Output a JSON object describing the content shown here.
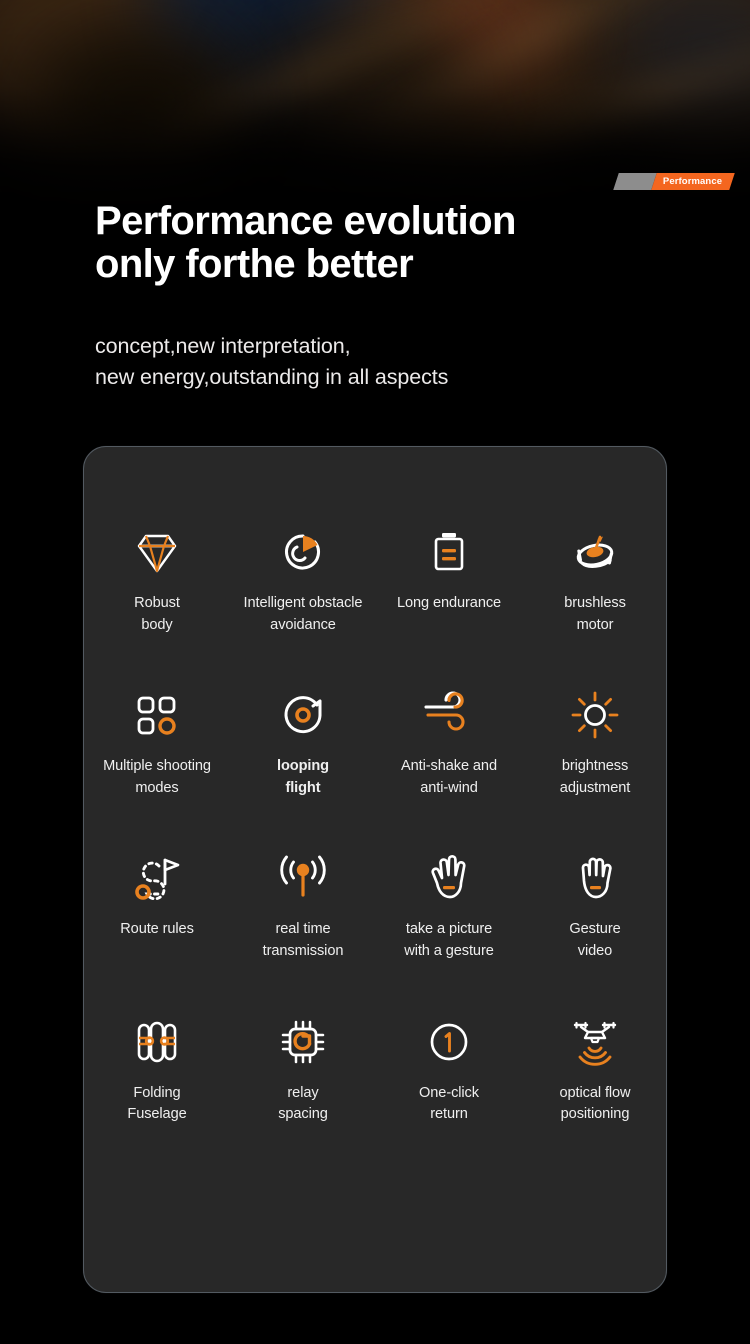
{
  "badge": {
    "gray_label": "",
    "label": "Performance"
  },
  "header": {
    "headline": "Performance evolution\nonly forthe better",
    "subtitle": "concept,new interpretation,\nnew energy,outstanding in all aspects"
  },
  "colors": {
    "accent_orange": "#e8811f",
    "badge_orange": "#f4661f",
    "badge_gray": "#8d8d8d",
    "icon_white": "#ffffff",
    "card_bg": "#282828",
    "card_border": "#535a61",
    "page_bg": "#000000",
    "text_white": "#efefef"
  },
  "features": [
    {
      "icon": "diamond-icon",
      "label": "Robust\nbody",
      "bold": false
    },
    {
      "icon": "obstacle-avoidance-icon",
      "label": "Intelligent obstacle\navoidance",
      "bold": false
    },
    {
      "icon": "battery-icon",
      "label": "Long endurance",
      "bold": false
    },
    {
      "icon": "brushless-motor-icon",
      "label": "brushless\nmotor",
      "bold": false
    },
    {
      "icon": "multi-shot-grid-icon",
      "label": "Multiple shooting\nmodes",
      "bold": false
    },
    {
      "icon": "looping-flight-icon",
      "label": "looping\nflight",
      "bold": true
    },
    {
      "icon": "wind-icon",
      "label": "Anti-shake and\nanti-wind",
      "bold": false
    },
    {
      "icon": "brightness-sun-icon",
      "label": "brightness\nadjustment",
      "bold": false
    },
    {
      "icon": "route-flag-icon",
      "label": "Route rules",
      "bold": false
    },
    {
      "icon": "signal-tower-icon",
      "label": "real time\ntransmission",
      "bold": false
    },
    {
      "icon": "open-hand-icon",
      "label": "take a picture\nwith a gesture",
      "bold": false
    },
    {
      "icon": "closed-hand-icon",
      "label": "Gesture\nvideo",
      "bold": false
    },
    {
      "icon": "folding-fuselage-icon",
      "label": "Folding\nFuselage",
      "bold": false
    },
    {
      "icon": "chip-icon",
      "label": "relay\nspacing",
      "bold": false
    },
    {
      "icon": "one-click-return-icon",
      "label": "One-click\nreturn",
      "bold": false
    },
    {
      "icon": "optical-flow-drone-icon",
      "label": "optical flow\npositioning",
      "bold": false
    }
  ]
}
